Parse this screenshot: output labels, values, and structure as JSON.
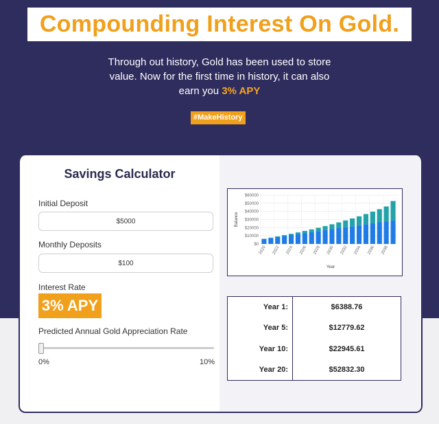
{
  "header": {
    "title": "Compounding Interest On Gold.",
    "subtitle_line1": "Through out history, Gold has been used to store",
    "subtitle_line2": "value. Now for the first time in history, it can also",
    "subtitle_line3_prefix": "earn you",
    "subtitle_apy": "3% APY",
    "hashtag": "#MakeHistory"
  },
  "calculator": {
    "title": "Savings Calculator",
    "initial_deposit_label": "Initial Deposit",
    "initial_deposit_value": "$5000",
    "monthly_deposits_label": "Monthly Deposits",
    "monthly_deposits_value": "$100",
    "interest_rate_label": "Interest Rate",
    "interest_rate_value": "3% APY",
    "appreciation_label": "Predicted Annual Gold Appreciation Rate",
    "slider_min": "0%",
    "slider_max": "10%",
    "slider_value": 0
  },
  "results": [
    {
      "label": "Year 1:",
      "value": "$6388.76"
    },
    {
      "label": "Year 5:",
      "value": "$12779.62"
    },
    {
      "label": "Year 10:",
      "value": "$22945.61"
    },
    {
      "label": "Year 20:",
      "value": "$52832.30"
    }
  ],
  "colors": {
    "deposit": "#1f7be6",
    "interest": "#22a3a9",
    "accent": "#f0a01b",
    "navy": "#2f2c5e"
  },
  "chart_data": {
    "type": "bar",
    "stacked": true,
    "ylabel": "Balance",
    "xlabel": "Year",
    "ylim": [
      0,
      60000
    ],
    "yticks": [
      "$0",
      "$10000",
      "$20000",
      "$30000",
      "$40000",
      "$50000",
      "$60000"
    ],
    "categories": [
      "2020",
      "2021",
      "2022",
      "2023",
      "2024",
      "2025",
      "2026",
      "2027",
      "2028",
      "2029",
      "2030",
      "2031",
      "2032",
      "2033",
      "2034",
      "2035",
      "2036",
      "2037",
      "2038",
      "2039"
    ],
    "xtick_labels": [
      "2020",
      "2022",
      "2024",
      "2026",
      "2028",
      "2030",
      "2032",
      "2034",
      "2036",
      "2038"
    ],
    "series": [
      {
        "values": [
          6200,
          7400,
          8600,
          9800,
          11000,
          12200,
          13400,
          14600,
          15800,
          17000,
          18200,
          19400,
          20600,
          21800,
          23000,
          24200,
          25400,
          26600,
          27800,
          29000
        ]
      },
      {
        "values": [
          200,
          400,
          700,
          1100,
          1500,
          2000,
          2600,
          3300,
          4100,
          5000,
          6000,
          7100,
          8300,
          9600,
          11000,
          12600,
          14300,
          16200,
          18300,
          23800
        ]
      }
    ]
  }
}
